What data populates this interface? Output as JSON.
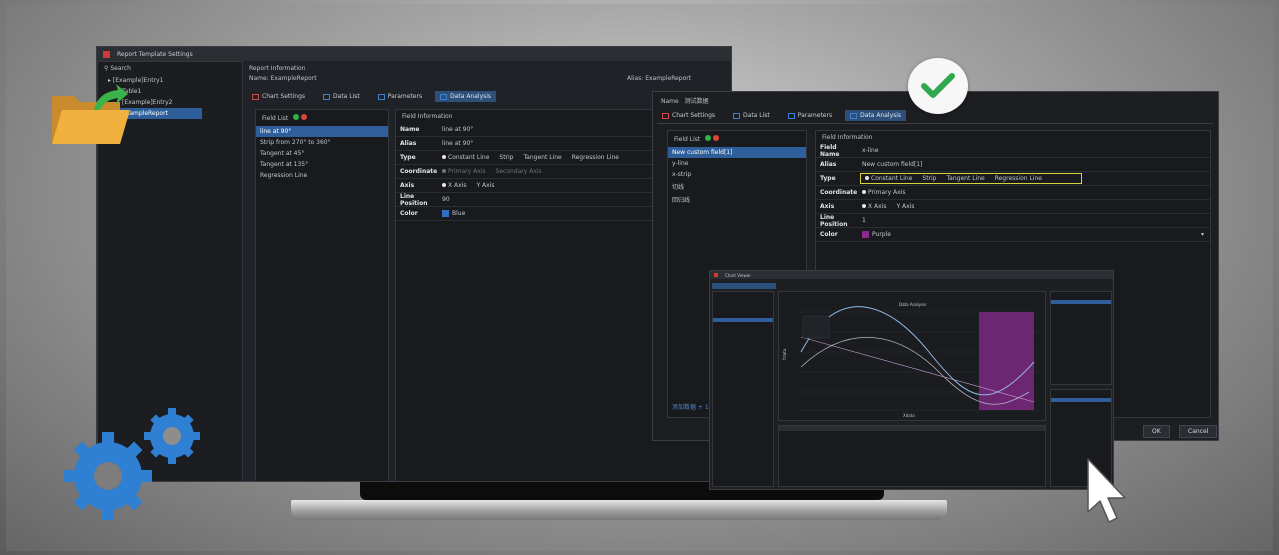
{
  "back_window": {
    "title": "Report Template Settings",
    "search_label": "Search",
    "tree": [
      "[Example]Entry1",
      "Table1",
      "[Example]Entry2",
      "ExampleReport"
    ],
    "report_info_label": "Report Information",
    "name_label": "Name",
    "name_value": "ExampleReport",
    "alias_label": "Alias",
    "alias_value": "ExampleReport",
    "tabs": [
      "Chart Settings",
      "Data List",
      "Parameters",
      "Data Analysis"
    ],
    "field_list_label": "Field List",
    "fields": [
      "line at 90°",
      "Strip from 270° to 360°",
      "Tangent at 45°",
      "Tangent at 135°",
      "Regression Line"
    ],
    "field_info_label": "Field Information",
    "props": {
      "name_k": "Name",
      "name_v": "line at 90°",
      "alias_k": "Alias",
      "alias_v": "line at 90°",
      "type_k": "Type",
      "type_opts": [
        "Constant Line",
        "Strip",
        "Tangent Line",
        "Regression Line"
      ],
      "coord_k": "Coordinate",
      "coord_opts": [
        "Primary Axis",
        "Secondary Axis"
      ],
      "axis_k": "Axis",
      "axis_opts": [
        "X Axis",
        "Y Axis"
      ],
      "linepos_k": "Line Position",
      "linepos_v": "90",
      "color_k": "Color",
      "color_v": "Blue"
    }
  },
  "front_window": {
    "name_label": "Name",
    "name_value": "测试数据",
    "tabs": [
      "Chart Settings",
      "Data List",
      "Parameters",
      "Data Analysis"
    ],
    "field_list_label": "Field List",
    "fields": [
      "New custom field[1]",
      "y-line",
      "x-strip",
      "切线",
      "回归线"
    ],
    "field_info_label": "Field Information",
    "props": {
      "field_name_k": "Field Name",
      "field_name_v": "x-line",
      "alias_k": "Alias",
      "alias_v": "New custom field[1]",
      "type_k": "Type",
      "type_opts": [
        "Constant Line",
        "Strip",
        "Tangent Line",
        "Regression Line"
      ],
      "coord_k": "Coordinate",
      "coord_v": "Primary Axis",
      "axis_k": "Axis",
      "axis_opts": [
        "X Axis",
        "Y Axis"
      ],
      "linepos_k": "Line Position",
      "linepos_v": "1",
      "color_k": "Color",
      "color_v": "Purple"
    },
    "ok_label": "OK",
    "cancel_label": "Cancel",
    "footer_text": "添加数据 + 1.0x"
  },
  "chart_window": {
    "title": "Chart Viewer",
    "chart_title": "Data Analysis",
    "xlabel": "Xdata",
    "ylabel": "Ydata"
  },
  "colors": {
    "accent_blue": "#2e6fc4",
    "selection": "#2e5f9a",
    "purple_strip": "#8a2a8f",
    "check_green": "#2fa84f",
    "highlight_yellow": "#d7d23a"
  }
}
